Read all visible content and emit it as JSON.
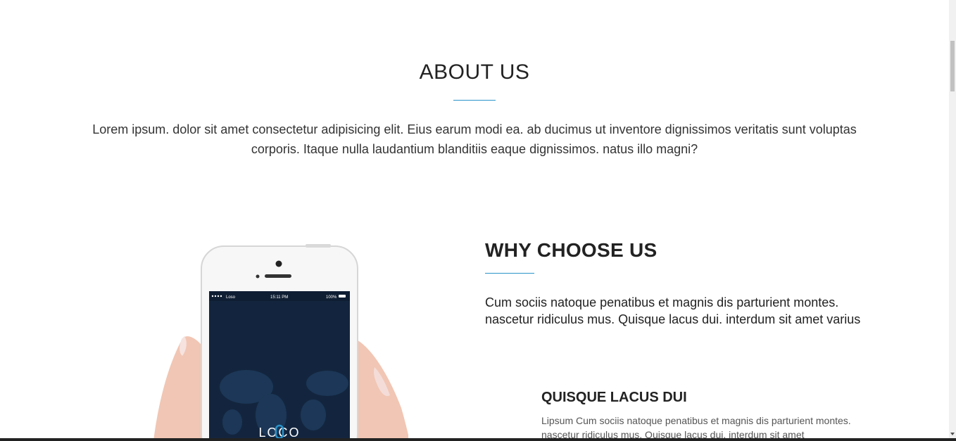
{
  "about": {
    "title": "ABOUT US",
    "text": "Lorem ipsum. dolor sit amet consectetur adipisicing elit. Eius earum modi ea. ab ducimus ut inventore dignissimos veritatis sunt voluptas corporis. Itaque nulla laudantium blanditiis eaque dignissimos. natus illo magni?"
  },
  "why": {
    "title": "WHY CHOOSE US",
    "text": "Cum sociis natoque penatibus et magnis dis parturient montes. nascetur ridiculus mus. Quisque lacus dui. interdum sit amet varius"
  },
  "feature": {
    "title": "QUISQUE LACUS DUI",
    "text": "Lipsum Cum sociis natoque penatibus et magnis dis parturient montes. nascetur ridiculus mus. Quisque lacus dui. interdum sit amet"
  },
  "phone": {
    "carrier": "Loso",
    "time": "15:11 PM",
    "battery": "100%",
    "app_logo": "LOCO"
  },
  "colors": {
    "accent": "#2a93c9",
    "screen": "#13253e"
  }
}
